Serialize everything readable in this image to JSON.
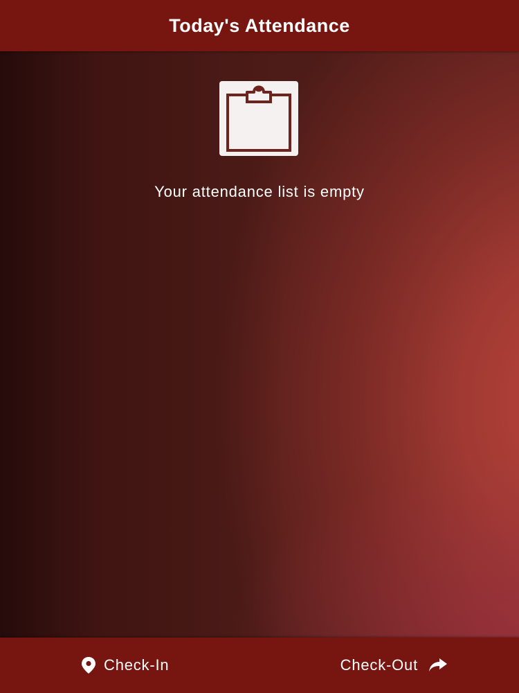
{
  "header": {
    "title": "Today's Attendance"
  },
  "empty_state": {
    "icon": "clipboard-icon",
    "message": "Your attendance list is empty"
  },
  "footer": {
    "check_in": {
      "label": "Check-In",
      "icon": "map-marker-icon"
    },
    "check_out": {
      "label": "Check-Out",
      "icon": "share-arrow-icon"
    }
  },
  "colors": {
    "bar": "#771510",
    "text": "#ffffff",
    "accent_gradient_light": "#b9433b",
    "accent_gradient_dark": "#2a0c0a"
  }
}
